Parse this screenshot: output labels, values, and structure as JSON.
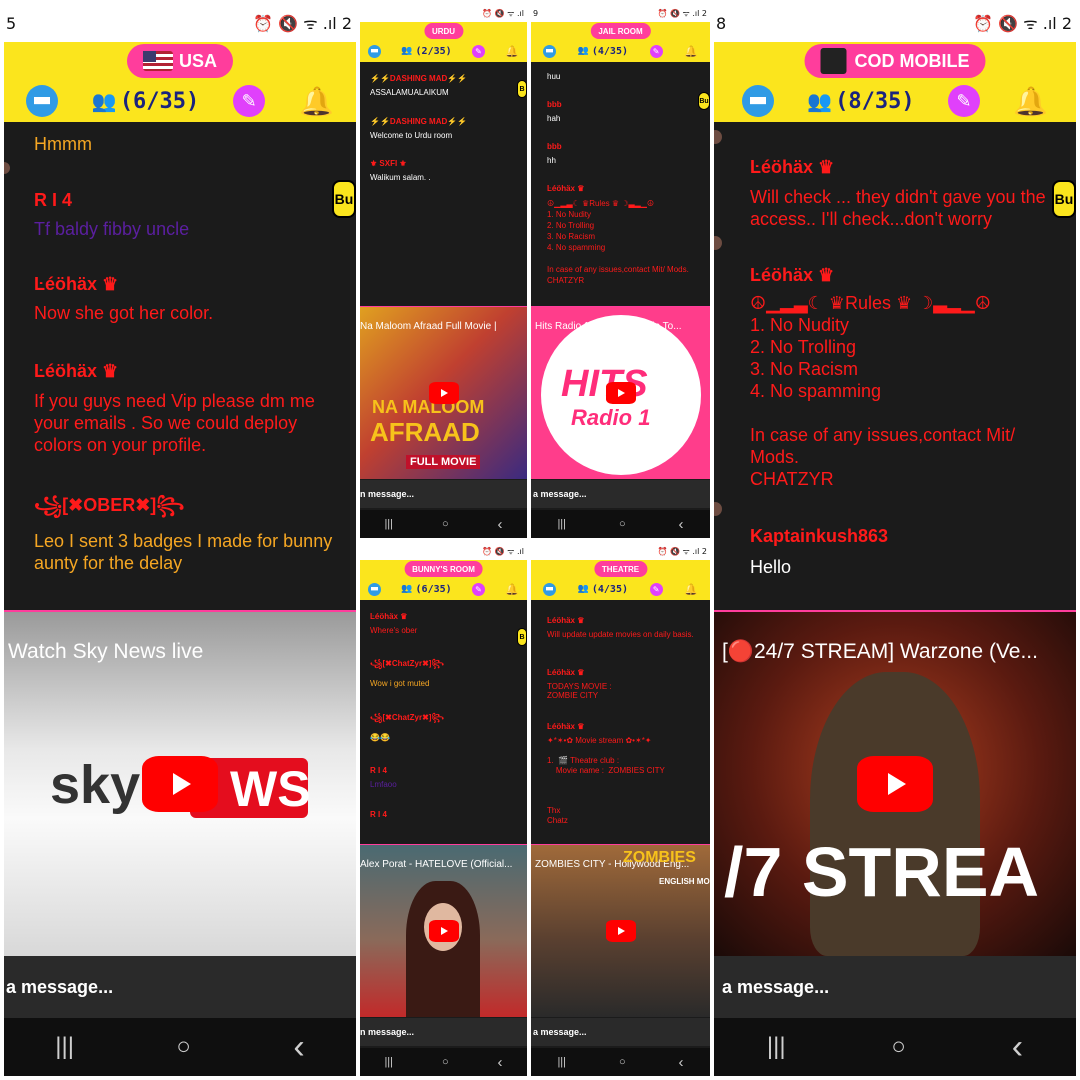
{
  "colors": {
    "yellow": "#fbe51d",
    "pink": "#ff3d9c",
    "red": "#ff1a1a",
    "orange": "#f5a623",
    "purple": "#5b1fa0",
    "white": "#ffffff"
  },
  "icons": {
    "chat": "chat-bubbles-icon",
    "users": "users-group-icon",
    "edit": "pencil-icon",
    "bell": "bell-icon",
    "play": "youtube-play-icon",
    "nav_recent": "recent-apps-icon",
    "nav_home": "home-icon",
    "nav_back": "back-icon"
  },
  "panel_usa": {
    "status_lead": "5",
    "status_icons": "⏰ 🔇 ᯤ .ıl 2",
    "room": "USA",
    "count": "(6/35)",
    "messages": [
      {
        "user": "",
        "text": "Hmmm"
      },
      {
        "user": "R I 4",
        "text": "Tf baldy fibby uncle"
      },
      {
        "user": "Ŀéöhäx ♛",
        "text": "Now she got her color."
      },
      {
        "user": "Ŀéöhäx ♛",
        "text": "If you guys need Vip please dm me your emails . So we could deploy colors on your profile."
      },
      {
        "user": "꧁[✖OBER✖]꧂",
        "text": "Leo I sent 3 badges I made for bunny aunty for the delay"
      }
    ],
    "video_title": "Watch Sky News live",
    "logo_left": "sky",
    "logo_right": "WS",
    "side_button": "Bu",
    "input": "a message..."
  },
  "panel_urdu": {
    "status_icons": "⏰ 🔇 ᯤ .ıl",
    "room": "URDU",
    "count": "(2/35)",
    "messages": [
      {
        "user": "⚡⚡DASHING MAD⚡⚡",
        "text": "ASSALAMUALAIKUM"
      },
      {
        "user": "⚡⚡DASHING MAD⚡⚡",
        "text": "Welcome to Urdu room"
      },
      {
        "user": "⚜ SXFI ⚜",
        "text": "Walikum salam. ."
      }
    ],
    "video_title": "Na Maloom Afraad Full Movie |",
    "poster_line1": "NA MALOOM",
    "poster_line2": "AFRAAD",
    "poster_line3": "FULL MOVIE",
    "side_button": "B",
    "input": "n message..."
  },
  "panel_jail": {
    "status_lead": "9",
    "status_icons": "⏰ 🔇 ᯤ .ıl 2",
    "room": "JAIL ROOM",
    "count": "(4/35)",
    "messages": [
      {
        "user": "",
        "text": "huu"
      },
      {
        "user": "bbb",
        "text": "hah"
      },
      {
        "user": "bbb",
        "text": "hh"
      },
      {
        "user": "Ŀéöhäx ♛",
        "text": "☮▁▂▃☾ ♛Rules ♛ ☽▃▂▁☮\n1. No Nudity\n2. No Trolling\n3. No Racism\n4. No spamming\n\nIn case of any issues,contact Mit/ Mods.\nCHATZYR"
      }
    ],
    "video_title": "Hits Radio 1 Live Pop Radio To...",
    "logo_line1": "HITS",
    "logo_line2": "Radio 1",
    "side_button": "Bu",
    "input": "a message..."
  },
  "panel_bunny": {
    "status_icons": "⏰ 🔇 ᯤ .ıl",
    "room": "BUNNY'S ROOM",
    "count": "(6/35)",
    "messages": [
      {
        "user": "Ŀéöhäx ♛",
        "text": "Where's ober"
      },
      {
        "user": "꧁[✖ChatZyr✖]꧂",
        "text": "Wow i got muted"
      },
      {
        "user": "꧁[✖ChatZyr✖]꧂",
        "text": "😂😂"
      },
      {
        "user": "R I 4",
        "text": "Lmfaoo"
      },
      {
        "user": "R I 4",
        "text": ""
      }
    ],
    "video_title": "Alex Porat - HATELOVE (Official...",
    "side_button": "B",
    "input": "n message..."
  },
  "panel_theatre": {
    "status_icons": "⏰ 🔇 ᯤ .ıl 2",
    "room": "THEATRE",
    "count": "(4/35)",
    "messages": [
      {
        "user": "Ŀéöhäx ♛",
        "text": "Will update update movies on daily basis."
      },
      {
        "user": "Ŀéöhäx ♛",
        "text": "TODAYS MOVIE :\nZOMBIE CITY"
      },
      {
        "user": "Ŀéöhäx ♛",
        "text": "✦*✶•✿ Movie stream ✿•✶*✦\n\n1.  🎬 Theatre club :\n    Movie name :  ZOMBIES CITY\n\n\n\nThx\nChatz"
      }
    ],
    "video_title": "ZOMBIES CITY - Hollywood Eng...",
    "poster_line1": "ZOMBIES",
    "poster_line2": "ENGLISH MO",
    "input": "a message..."
  },
  "panel_cod": {
    "status_lead": "8",
    "status_icons": "⏰ 🔇 ᯤ .ıl 2",
    "room": "COD MOBILE",
    "count": "(8/35)",
    "messages": [
      {
        "user": "Ŀéöhäx ♛",
        "text": "Will check ... they didn't gave you the access..  I'll check...don't worry"
      },
      {
        "user": "Ŀéöhäx ♛",
        "text": "☮▁▂▃☾ ♛Rules ♛ ☽▃▂▁☮\n1. No Nudity\n2. No Trolling\n3. No Racism\n4. No spamming\n\nIn case of any issues,contact Mit/ Mods.\nCHATZYR"
      },
      {
        "user": "Kaptainkush863",
        "text": "Hello"
      }
    ],
    "video_title": "[🔴24/7 STREAM] Warzone (Ve...",
    "poster_text": "/7 STREA",
    "side_button": "Bu",
    "input": "a message..."
  },
  "nav": {
    "recent": "|||",
    "home": "○",
    "back": "‹"
  }
}
